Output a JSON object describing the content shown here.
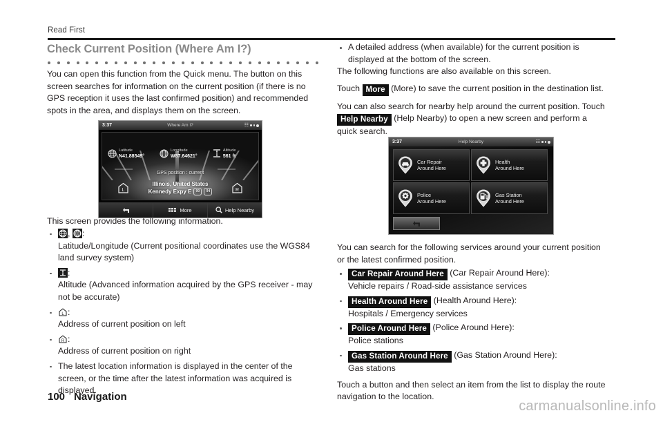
{
  "running_head": "Read First",
  "title": "Check Current Position (Where Am I?)",
  "page_footer": {
    "page_number": "100",
    "section": "Navigation",
    "watermark": "carmanualsonline.info"
  },
  "left_column": {
    "intro": "You can open this function from the Quick menu. The button on this screen searches for information on the current position (if there is no GPS reception it uses the last confirmed position) and recommended spots in the area, and displays them on the screen.",
    "after_image_lead": "This screen provides the following information.",
    "bullets": [
      {
        "icons": [
          "globe-latitude-icon",
          "globe-longitude-icon"
        ],
        "label": ":",
        "text": "Latitude/Longitude (Current positional coordinates use the WGS84 land survey system)"
      },
      {
        "icons": [
          "altitude-icon"
        ],
        "label": ":",
        "text": "Altitude (Advanced information acquired by the GPS receiver - may not be accurate)"
      },
      {
        "icons": [
          "house-left-icon"
        ],
        "label": ":",
        "text": "Address of current position on left"
      },
      {
        "icons": [
          "house-right-icon"
        ],
        "label": ":",
        "text": "Address of current position on right"
      },
      {
        "icons": [],
        "label": "",
        "text": "The latest location information is displayed in the center of the screen, or the time after the latest information was acquired is displayed."
      }
    ]
  },
  "right_column": {
    "top_bullet": "A detailed address (when available) for the current position is displayed at the bottom of the screen.",
    "para_functions": "The following functions are also available on this screen.",
    "para_more_pre": "Touch",
    "para_more_chip": "More",
    "para_more_post": "(More) to save the current position in the destination list.",
    "para_help_pre": "You can also search for nearby help around the current position. Touch",
    "para_help_chip": "Help Nearby",
    "para_help_post": "(Help Nearby) to open a new screen and perform a quick search.",
    "para_services": "You can search for the following services around your current position or the latest confirmed position.",
    "services": [
      {
        "chip": "Car Repair Around Here",
        "paren": "(Car Repair Around Here):",
        "desc": "Vehicle repairs / Road-side assistance services"
      },
      {
        "chip": "Health Around Here",
        "paren": "(Health Around Here):",
        "desc": "Hospitals / Emergency services"
      },
      {
        "chip": "Police Around Here",
        "paren": "(Police Around Here):",
        "desc": "Police stations"
      },
      {
        "chip": "Gas Station Around Here",
        "paren": "(Gas Station Around Here):",
        "desc": "Gas stations"
      }
    ],
    "closing": "Touch a button and then select an item from the list to display the route navigation to the location."
  },
  "screenshot_whereami": {
    "status_clock": "3:37",
    "status_title": "Where Am I?",
    "latitude_label": "Latitude",
    "latitude_value": "N41.88549°",
    "longitude_label": "Longitude",
    "longitude_value": "W87.64621°",
    "altitude_label": "Altitude",
    "altitude_value": "561 ft",
    "gps_overlay": "GPS position : current",
    "house_left_letter": "L",
    "house_right_letter": "R",
    "place": "Illinois, United States",
    "street": "Kennedy Expy E",
    "shield_1": "90",
    "shield_2": "94",
    "btn_back": "back-arrow-icon",
    "btn_more": "More",
    "btn_help": "Help Nearby"
  },
  "screenshot_helpnearby": {
    "status_clock": "3:37",
    "status_title": "Help Nearby",
    "tiles": [
      {
        "icon": "car-repair-pin-icon",
        "line1": "Car Repair",
        "line2": "Around Here"
      },
      {
        "icon": "health-pin-icon",
        "line1": "Health",
        "line2": "Around Here"
      },
      {
        "icon": "police-pin-icon",
        "line1": "Police",
        "line2": "Around Here"
      },
      {
        "icon": "gas-station-pin-icon",
        "line1": "Gas Station",
        "line2": "Around Here"
      }
    ],
    "btn_back": "back-arrow-icon"
  },
  "colors": {
    "title_gray": "#8a8a8a",
    "body_black": "#231f20",
    "chip_black": "#111111",
    "rule_black": "#1a1a1a",
    "watermark_gray": "#b9b9b9"
  }
}
